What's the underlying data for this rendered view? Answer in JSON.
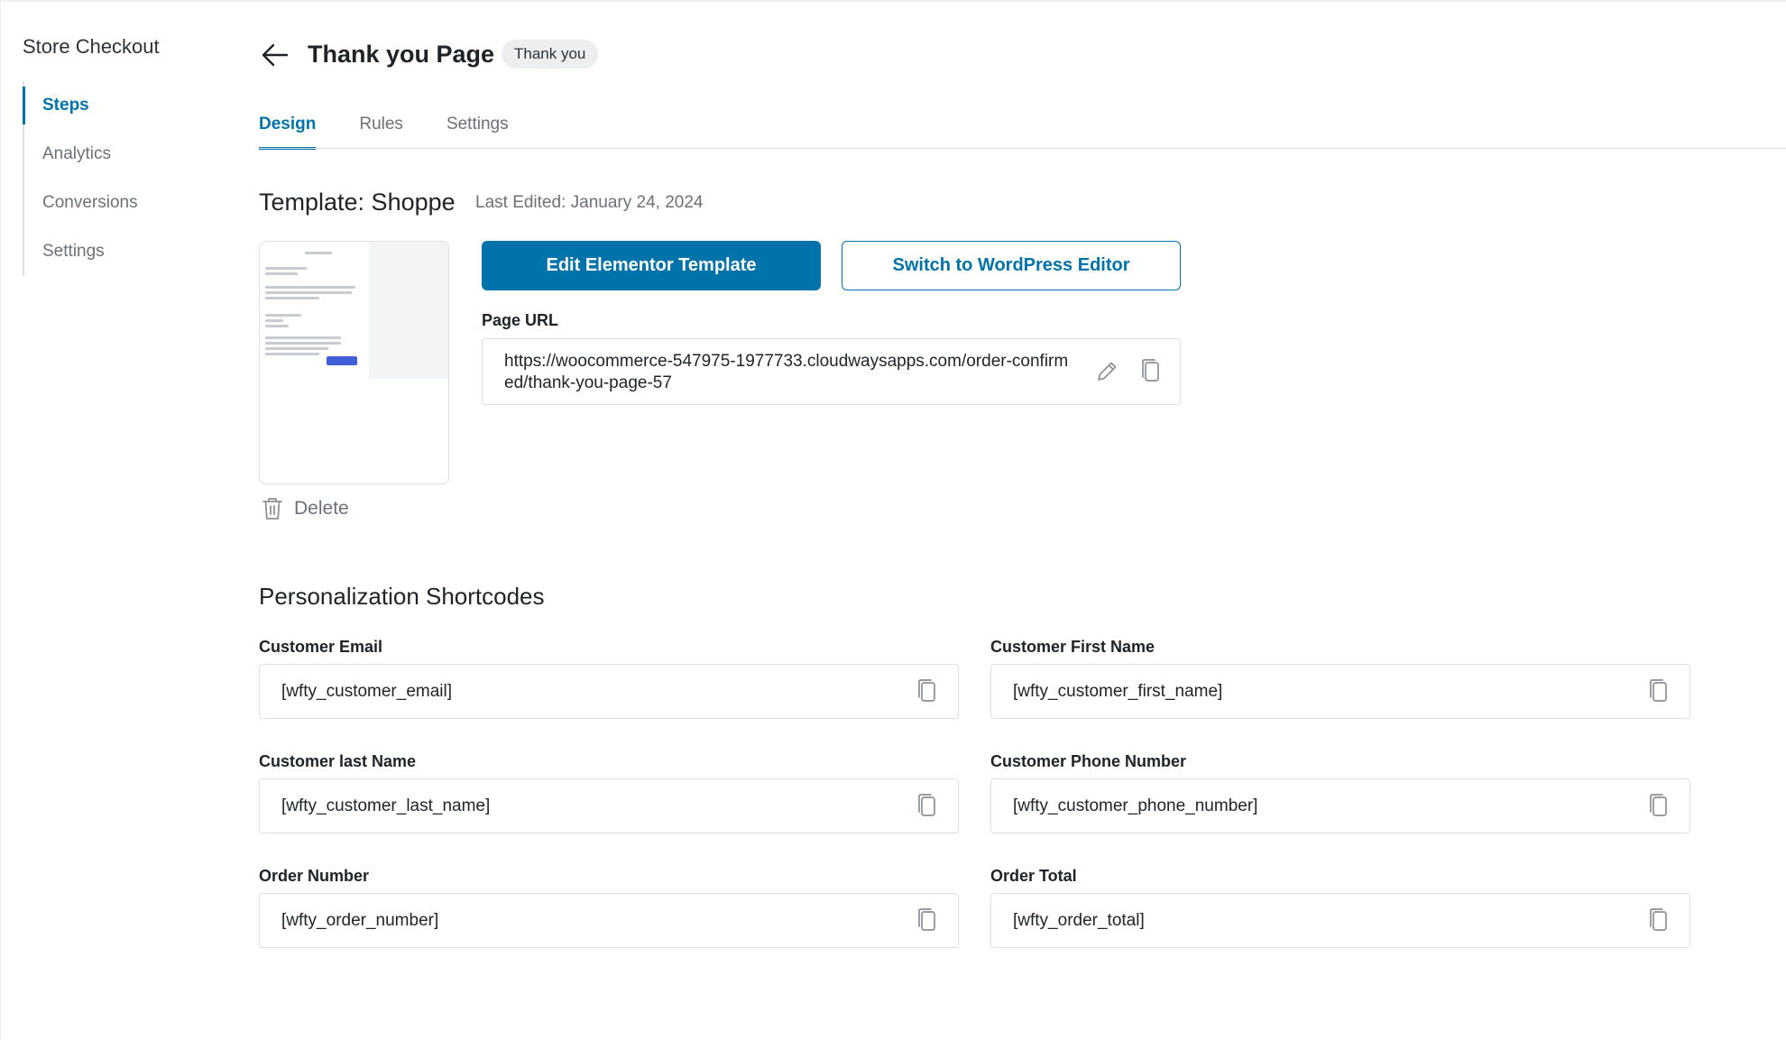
{
  "sidebar": {
    "title": "Store Checkout",
    "items": [
      {
        "label": "Steps",
        "active": true
      },
      {
        "label": "Analytics"
      },
      {
        "label": "Conversions"
      },
      {
        "label": "Settings"
      }
    ]
  },
  "header": {
    "title": "Thank you Page",
    "badge": "Thank you"
  },
  "tabs": [
    {
      "label": "Design",
      "active": true
    },
    {
      "label": "Rules"
    },
    {
      "label": "Settings"
    }
  ],
  "template": {
    "title": "Template: Shoppe",
    "last_edited": "Last Edited: January 24, 2024",
    "delete_label": "Delete",
    "primary_button": "Edit Elementor Template",
    "secondary_button": "Switch to WordPress Editor",
    "page_url_label": "Page URL",
    "page_url": "https://woocommerce-547975-1977733.cloudwaysapps.com/order-confirmed/thank-you-page-57"
  },
  "shortcodes": {
    "title": "Personalization Shortcodes",
    "fields": [
      {
        "label": "Customer Email",
        "value": "[wfty_customer_email]"
      },
      {
        "label": "Customer First Name",
        "value": "[wfty_customer_first_name]"
      },
      {
        "label": "Customer last Name",
        "value": "[wfty_customer_last_name]"
      },
      {
        "label": "Customer Phone Number",
        "value": "[wfty_customer_phone_number]"
      },
      {
        "label": "Order Number",
        "value": "[wfty_order_number]"
      },
      {
        "label": "Order Total",
        "value": "[wfty_order_total]"
      }
    ]
  },
  "colors": {
    "accent": "#0073aa",
    "text": "#1d2327",
    "muted": "#6b7177",
    "border": "#dcdfe3"
  },
  "icons": {
    "back": "arrow-left-icon",
    "delete": "trash-icon",
    "edit": "pencil-icon",
    "copy": "copy-icon"
  }
}
